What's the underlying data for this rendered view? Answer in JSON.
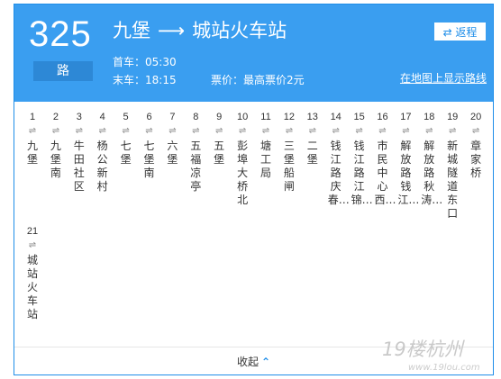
{
  "header": {
    "route_number": "325",
    "route_unit": "路",
    "origin": "九堡",
    "arrow": "⟶",
    "destination": "城站火车站",
    "first_bus": "首车：05:30",
    "last_bus": "末车：18:15",
    "fare": "票价：最高票价2元",
    "return_button": "⇄ 返程",
    "map_link": "在地图上显示路线"
  },
  "stops": [
    {
      "num": "1",
      "dir": "⇌",
      "name": "九堡"
    },
    {
      "num": "2",
      "dir": "⇌",
      "name": "九堡南"
    },
    {
      "num": "3",
      "dir": "⇌",
      "name": "牛田社区"
    },
    {
      "num": "4",
      "dir": "⇌",
      "name": "杨公新村"
    },
    {
      "num": "5",
      "dir": "⇌",
      "name": "七堡"
    },
    {
      "num": "6",
      "dir": "⇌",
      "name": "七堡南"
    },
    {
      "num": "7",
      "dir": "⇌",
      "name": "六堡"
    },
    {
      "num": "8",
      "dir": "⇌",
      "name": "五福凉亭"
    },
    {
      "num": "9",
      "dir": "⇌",
      "name": "五堡"
    },
    {
      "num": "10",
      "dir": "⇌",
      "name": "彭埠大桥北"
    },
    {
      "num": "11",
      "dir": "⇌",
      "name": "塘工局"
    },
    {
      "num": "12",
      "dir": "⇌",
      "name": "三堡船闸"
    },
    {
      "num": "13",
      "dir": "⇌",
      "name": "二堡"
    },
    {
      "num": "14",
      "dir": "⇌",
      "name": "钱江路庆春…"
    },
    {
      "num": "15",
      "dir": "⇌",
      "name": "钱江路江锦…"
    },
    {
      "num": "16",
      "dir": "⇌",
      "name": "市民中心西…"
    },
    {
      "num": "17",
      "dir": "⇌",
      "name": "解放路钱江…"
    },
    {
      "num": "18",
      "dir": "⇌",
      "name": "解放路秋涛…"
    },
    {
      "num": "19",
      "dir": "⇌",
      "name": "新城隧道东口"
    },
    {
      "num": "20",
      "dir": "⇌",
      "name": "章家桥"
    },
    {
      "num": "21",
      "dir": "⇌",
      "name": "城站火车站"
    }
  ],
  "footer": {
    "collapse_label": "收起",
    "collapse_icon": "chevron-up-icon"
  },
  "watermark": {
    "brand": "19楼杭州",
    "url": "www.19lou.com"
  },
  "colors": {
    "header_bg": "#3a9ef0",
    "unit_bg": "#2d88d6",
    "accent": "#1f8ee9",
    "border": "#1f8ee9"
  }
}
